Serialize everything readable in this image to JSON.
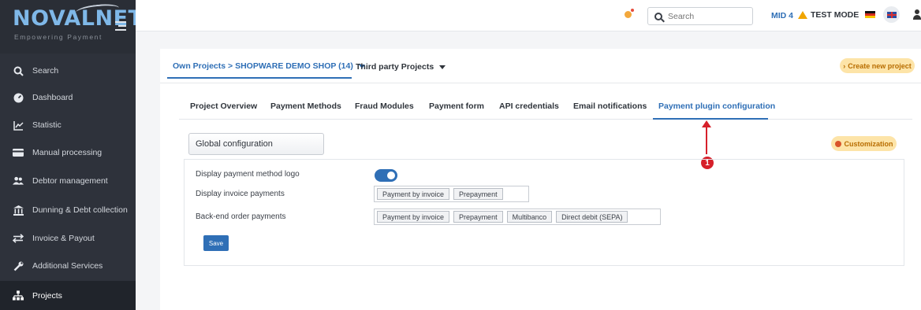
{
  "brand": {
    "name": "NOVALNET",
    "tagline": "Empowering Payment"
  },
  "sidebar": {
    "items": [
      {
        "label": "Search",
        "icon": "search-icon"
      },
      {
        "label": "Dashboard",
        "icon": "dashboard-icon"
      },
      {
        "label": "Statistic",
        "icon": "chart-icon"
      },
      {
        "label": "Manual processing",
        "icon": "credit-card-icon"
      },
      {
        "label": "Debtor management",
        "icon": "users-icon"
      },
      {
        "label": "Dunning & Debt collection",
        "icon": "bank-icon"
      },
      {
        "label": "Invoice & Payout",
        "icon": "exchange-icon"
      },
      {
        "label": "Additional Services",
        "icon": "wrench-icon"
      },
      {
        "label": "Projects",
        "icon": "sitemap-icon",
        "active": true
      }
    ]
  },
  "topbar": {
    "search_placeholder": "Search",
    "mid": "MID 4",
    "mode": "TEST MODE"
  },
  "projects": {
    "own": "Own Projects > SHOPWARE DEMO SHOP (14)",
    "third_party": "Third party Projects",
    "create_button": "Create new project"
  },
  "tabs": [
    {
      "label": "Project Overview"
    },
    {
      "label": "Payment Methods"
    },
    {
      "label": "Fraud Modules"
    },
    {
      "label": "Payment form"
    },
    {
      "label": "API credentials"
    },
    {
      "label": "Email notifications"
    },
    {
      "label": "Payment plugin configuration",
      "active": true
    }
  ],
  "config": {
    "scope_select": "Global configuration",
    "customization_button": "Customization",
    "logo_label": "Display payment method logo",
    "logo_enabled": true,
    "invoice_label": "Display invoice payments",
    "invoice_chips": [
      "Payment by invoice",
      "Prepayment"
    ],
    "backend_label": "Back-end order payments",
    "backend_chips": [
      "Payment by invoice",
      "Prepayment",
      "Multibanco",
      "Direct debit (SEPA)"
    ],
    "save_button": "Save"
  },
  "annotation": {
    "badge": "1"
  },
  "colors": {
    "sidebar_bg": "#2e323b",
    "accent": "#2f6fb6",
    "orange_button": "#fde4a8",
    "annotation": "#d6202a"
  }
}
